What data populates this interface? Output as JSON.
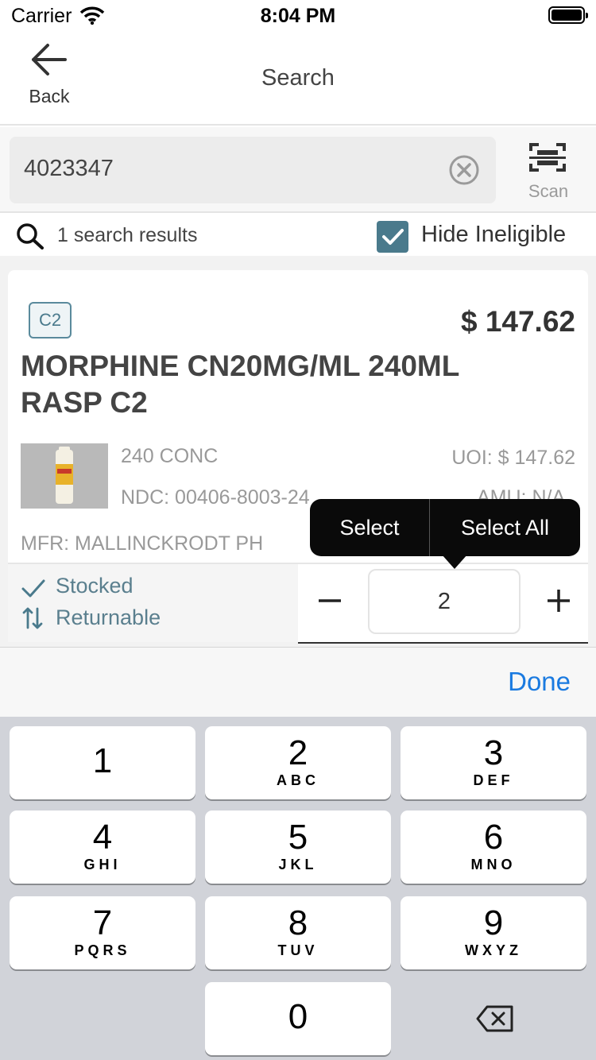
{
  "status_bar": {
    "carrier": "Carrier",
    "time": "8:04 PM"
  },
  "nav": {
    "back_label": "Back",
    "title": "Search"
  },
  "search": {
    "value": "4023347",
    "scan_label": "Scan"
  },
  "results": {
    "count_text": "1 search results",
    "hide_ineligible_label": "Hide Ineligible",
    "hide_ineligible_checked": true
  },
  "product": {
    "schedule_badge": "C2",
    "price": "$ 147.62",
    "name": "MORPHINE CN20MG/ML 240ML RASP  C2",
    "package": "240 CONC",
    "uoi": "UOI: $ 147.62",
    "ndc": "NDC: 00406-8003-24",
    "amu": "AMU: N/A",
    "mfr": "MFR: MALLINCKRODT PH",
    "stocked_label": "Stocked",
    "returnable_label": "Returnable",
    "quantity": "2"
  },
  "popover": {
    "select_label": "Select",
    "select_all_label": "Select All"
  },
  "keyboard_toolbar": {
    "done_label": "Done"
  },
  "keypad": [
    {
      "num": "1",
      "letters": ""
    },
    {
      "num": "2",
      "letters": "ABC"
    },
    {
      "num": "3",
      "letters": "DEF"
    },
    {
      "num": "4",
      "letters": "GHI"
    },
    {
      "num": "5",
      "letters": "JKL"
    },
    {
      "num": "6",
      "letters": "MNO"
    },
    {
      "num": "7",
      "letters": "PQRS"
    },
    {
      "num": "8",
      "letters": "TUV"
    },
    {
      "num": "9",
      "letters": "WXYZ"
    },
    {
      "num": "0",
      "letters": ""
    }
  ],
  "colors": {
    "accent": "#4a7a8c",
    "link": "#1a7ae0",
    "popover": "#0a0a0a"
  }
}
